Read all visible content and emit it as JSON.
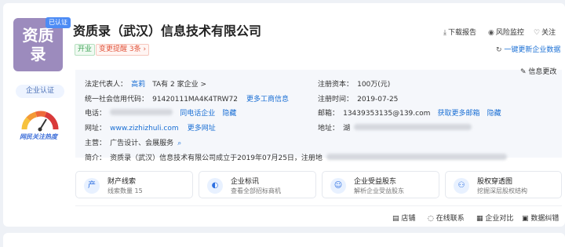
{
  "header": {
    "logo_text_line1": "资质",
    "logo_text_line2": "录",
    "logo_badge": "已认证",
    "company_name": "资质录（武汉）信息技术有限公司",
    "tag_status": "开业",
    "tag_change": "变更提醒 3条 ›",
    "actions": [
      {
        "icon": "download-icon",
        "glyph": "⤓",
        "label": "下载报告"
      },
      {
        "icon": "eye-icon",
        "glyph": "◉",
        "label": "风险监控"
      },
      {
        "icon": "heart-icon",
        "glyph": "♡",
        "label": "关注"
      }
    ],
    "update_link": "一键更新企业数据"
  },
  "sidebar": {
    "cert_label": "企业认证",
    "gauge_label": "网民关注热度"
  },
  "info": {
    "edit_label": "信息更改",
    "legal_rep_label": "法定代表人：",
    "legal_rep_value": "高莉",
    "legal_rep_extra": "TA有 2 家企业 >",
    "reg_capital_label": "注册资本：",
    "reg_capital_value": "100万(元)",
    "credit_code_label": "统一社会信用代码：",
    "credit_code_value": "91420111MA4K4TRW72",
    "credit_code_link": "更多工商信息",
    "reg_time_label": "注册时间：",
    "reg_time_value": "2019-07-25",
    "phone_label": "电话：",
    "phone_link": "同电话企业",
    "phone_hide": "隐藏",
    "email_label": "邮箱：",
    "email_value": "13439353135@139.com",
    "email_link": "获取更多邮箱",
    "email_hide": "隐藏",
    "website_label": "网址：",
    "website_value": "www.zizhizhuli.com",
    "website_link": "更多网址",
    "address_label": "地址：",
    "address_value": "湖",
    "business_label": "主营：",
    "business_value": "广告设计、会展服务",
    "intro_label": "简介：",
    "intro_value": "资质录（武汉）信息技术有限公司成立于2019年07月25日，注册地"
  },
  "features": [
    {
      "icon": "property-icon",
      "glyph": "产",
      "title": "财产线索",
      "sub": "线索数量 15"
    },
    {
      "icon": "bid-icon",
      "glyph": "◐",
      "title": "企业标讯",
      "sub": "查看全部招标商机"
    },
    {
      "icon": "shareholder-icon",
      "glyph": "☺",
      "title": "企业受益股东",
      "sub": "解析企业受益股东"
    },
    {
      "icon": "equity-icon",
      "glyph": "⚇",
      "title": "股权穿透图",
      "sub": "挖掘深层股权结构"
    }
  ],
  "bottom_actions": [
    {
      "icon": "shop-icon",
      "glyph": "▤",
      "label": "店铺"
    },
    {
      "icon": "chat-icon",
      "glyph": "◌",
      "label": "在线联系"
    },
    {
      "icon": "compare-icon",
      "glyph": "▦",
      "label": "企业对比"
    },
    {
      "icon": "error-icon",
      "glyph": "▣",
      "label": "数据纠错"
    }
  ],
  "colors": {
    "accent": "#1a6fd4",
    "logo_bg": "#9c8bbd",
    "tag_green": "#3aa152",
    "tag_red": "#e2563d"
  }
}
